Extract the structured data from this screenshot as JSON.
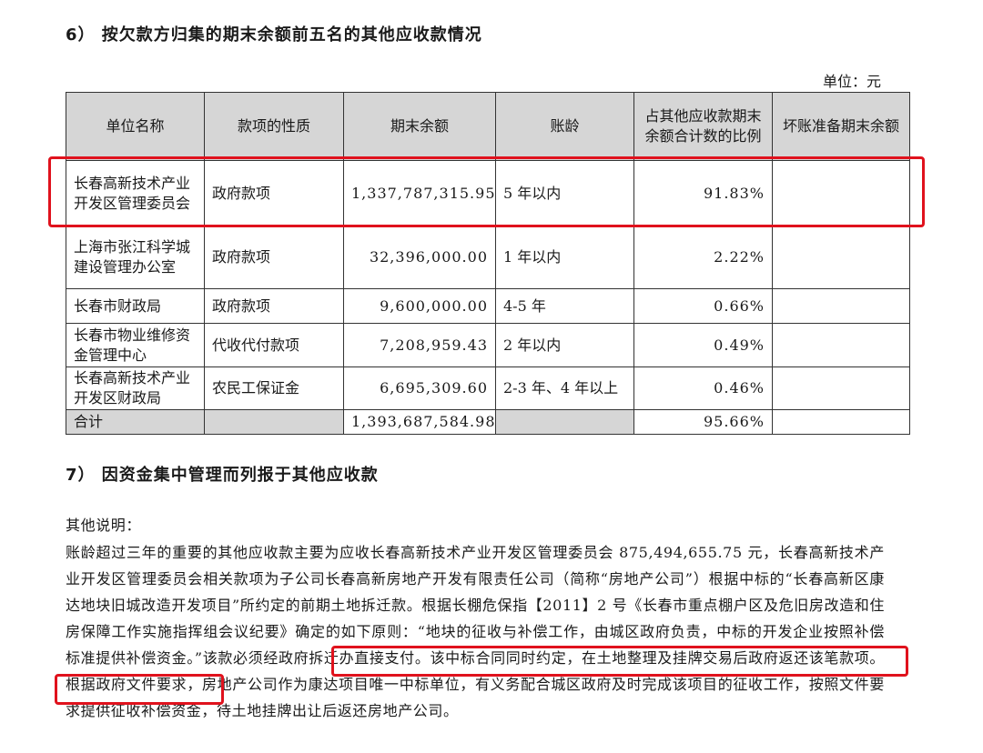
{
  "section6": {
    "title": "6） 按欠款方归集的期末余额前五名的其他应收款情况",
    "unit": "单位：元"
  },
  "table": {
    "headers": [
      "单位名称",
      "款项的性质",
      "期末余额",
      "账龄",
      "占其他应收款期末余额合计数的比例",
      "坏账准备期末余额"
    ],
    "rows": [
      [
        "长春高新技术产业开发区管理委员会",
        "政府款项",
        "1,337,787,315.95",
        "5 年以内",
        "91.83%",
        ""
      ],
      [
        "上海市张江科学城建设管理办公室",
        "政府款项",
        "32,396,000.00",
        "1 年以内",
        "2.22%",
        ""
      ],
      [
        "长春市财政局",
        "政府款项",
        "9,600,000.00",
        "4-5 年",
        "0.66%",
        ""
      ],
      [
        "长春市物业维修资金管理中心",
        "代收代付款项",
        "7,208,959.43",
        "2 年以内",
        "0.49%",
        ""
      ],
      [
        "长春高新技术产业开发区财政局",
        "农民工保证金",
        "6,695,309.60",
        "2-3 年、4 年以上",
        "0.46%",
        ""
      ]
    ],
    "total": {
      "label": "合计",
      "amount": "1,393,687,584.98",
      "ratio": "95.66%"
    }
  },
  "section7": {
    "title": "7） 因资金集中管理而列报于其他应收款"
  },
  "notes": {
    "label": "其他说明：",
    "text_before": "账龄超过三年的重要的其他应收款主要为应收长春高新技术产业开发区管理委员会 875,494,655.75 元，长春高新技术产业开发区管理委员会相关款项为子公司长春高新房地产开发有限责任公司（简称“房地产公司”）根据中标的“长春高新区康达地块旧城改造开发项目”所约定的前期土地拆迁款。根据长棚危保指【2011】2 号《长春市重点棚户区及危旧房改造和住房保障工作实施指挥组会议纪要》确定的如下原则：“地块的征收与补偿工作，由城区政府负责，中标的开发企业按照补偿标准提供补偿资金。”",
    "highlighted": "该款必须经政府拆迁办直接支付。该中标合同同时约定，在土地整理及挂牌交易后政府返还该笔款项。",
    "text_after": "根据政府文件要求，房地产公司作为康达项目唯一中标单位，有义务配合城区政府及时完成该项目的征收工作，按照文件要求提供征收补偿资金，待土地挂牌出让后返还房地产公司。"
  },
  "colors": {
    "highlight_box": "#e0121d",
    "header_bg": "#d6d6d6"
  }
}
